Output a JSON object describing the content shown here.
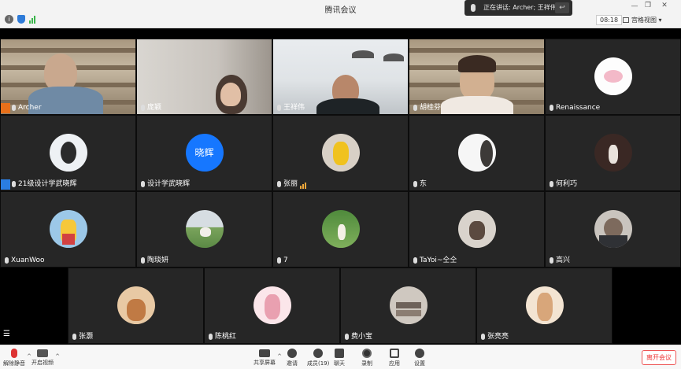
{
  "window": {
    "title": "腾讯会议",
    "clock": "08:18",
    "view_label": "宫格视图"
  },
  "talking_banner": {
    "text": "正在讲话: Archer; 王祥伟;"
  },
  "participants": [
    {
      "name": "Archer"
    },
    {
      "name": "庞颖"
    },
    {
      "name": "王祥伟"
    },
    {
      "name": "胡桂芬"
    },
    {
      "name": "Renaissance"
    },
    {
      "name": "21级设计学武晓辉"
    },
    {
      "name": "设计学武晓辉",
      "avatar_text": "晓辉"
    },
    {
      "name": "张丽"
    },
    {
      "name": "东"
    },
    {
      "name": "何利巧"
    },
    {
      "name": "XuanWoo"
    },
    {
      "name": "陶琰妍"
    },
    {
      "name": "7"
    },
    {
      "name": "TaYoi~仝仝"
    },
    {
      "name": "高兴"
    },
    {
      "name": "张灏"
    },
    {
      "name": "陈桃红"
    },
    {
      "name": "费小宝"
    },
    {
      "name": "张亮亮"
    }
  ],
  "toolbar": {
    "unmute": "解除静音",
    "start_video": "开启视频",
    "share_screen": "共享屏幕",
    "invite": "邀请",
    "members": "成员(19)",
    "chat": "聊天",
    "record": "录制",
    "apps": "应用",
    "settings": "设置",
    "leave": "离开会议"
  },
  "colors": {
    "accent": "#1677ff",
    "leave": "#e33333",
    "host_badge": "#e8701a"
  }
}
